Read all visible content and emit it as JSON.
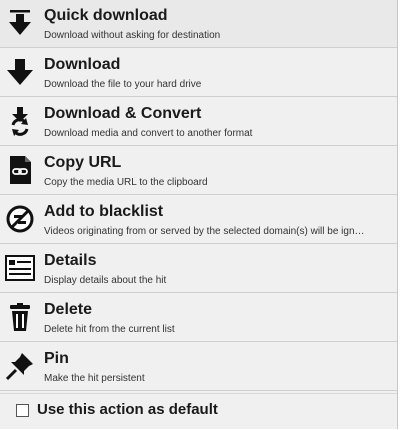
{
  "menu": {
    "items": [
      {
        "title": "Quick download",
        "description": "Download without asking for destination",
        "icon": "quick-download-icon"
      },
      {
        "title": "Download",
        "description": "Download the file to your hard drive",
        "icon": "download-icon"
      },
      {
        "title": "Download & Convert",
        "description": "Download media and convert to another format",
        "icon": "download-convert-icon"
      },
      {
        "title": "Copy URL",
        "description": "Copy the media URL to the clipboard",
        "icon": "copy-url-icon"
      },
      {
        "title": "Add to blacklist",
        "description": "Videos originating from or served by the selected domain(s) will be ign…",
        "icon": "blacklist-icon"
      },
      {
        "title": "Details",
        "description": "Display details about the hit",
        "icon": "details-icon"
      },
      {
        "title": "Delete",
        "description": "Delete hit from the current list",
        "icon": "trash-icon"
      },
      {
        "title": "Pin",
        "description": "Make the hit persistent",
        "icon": "pin-icon"
      }
    ],
    "default_checkbox_label": "Use this action as default",
    "default_checkbox_checked": false
  }
}
